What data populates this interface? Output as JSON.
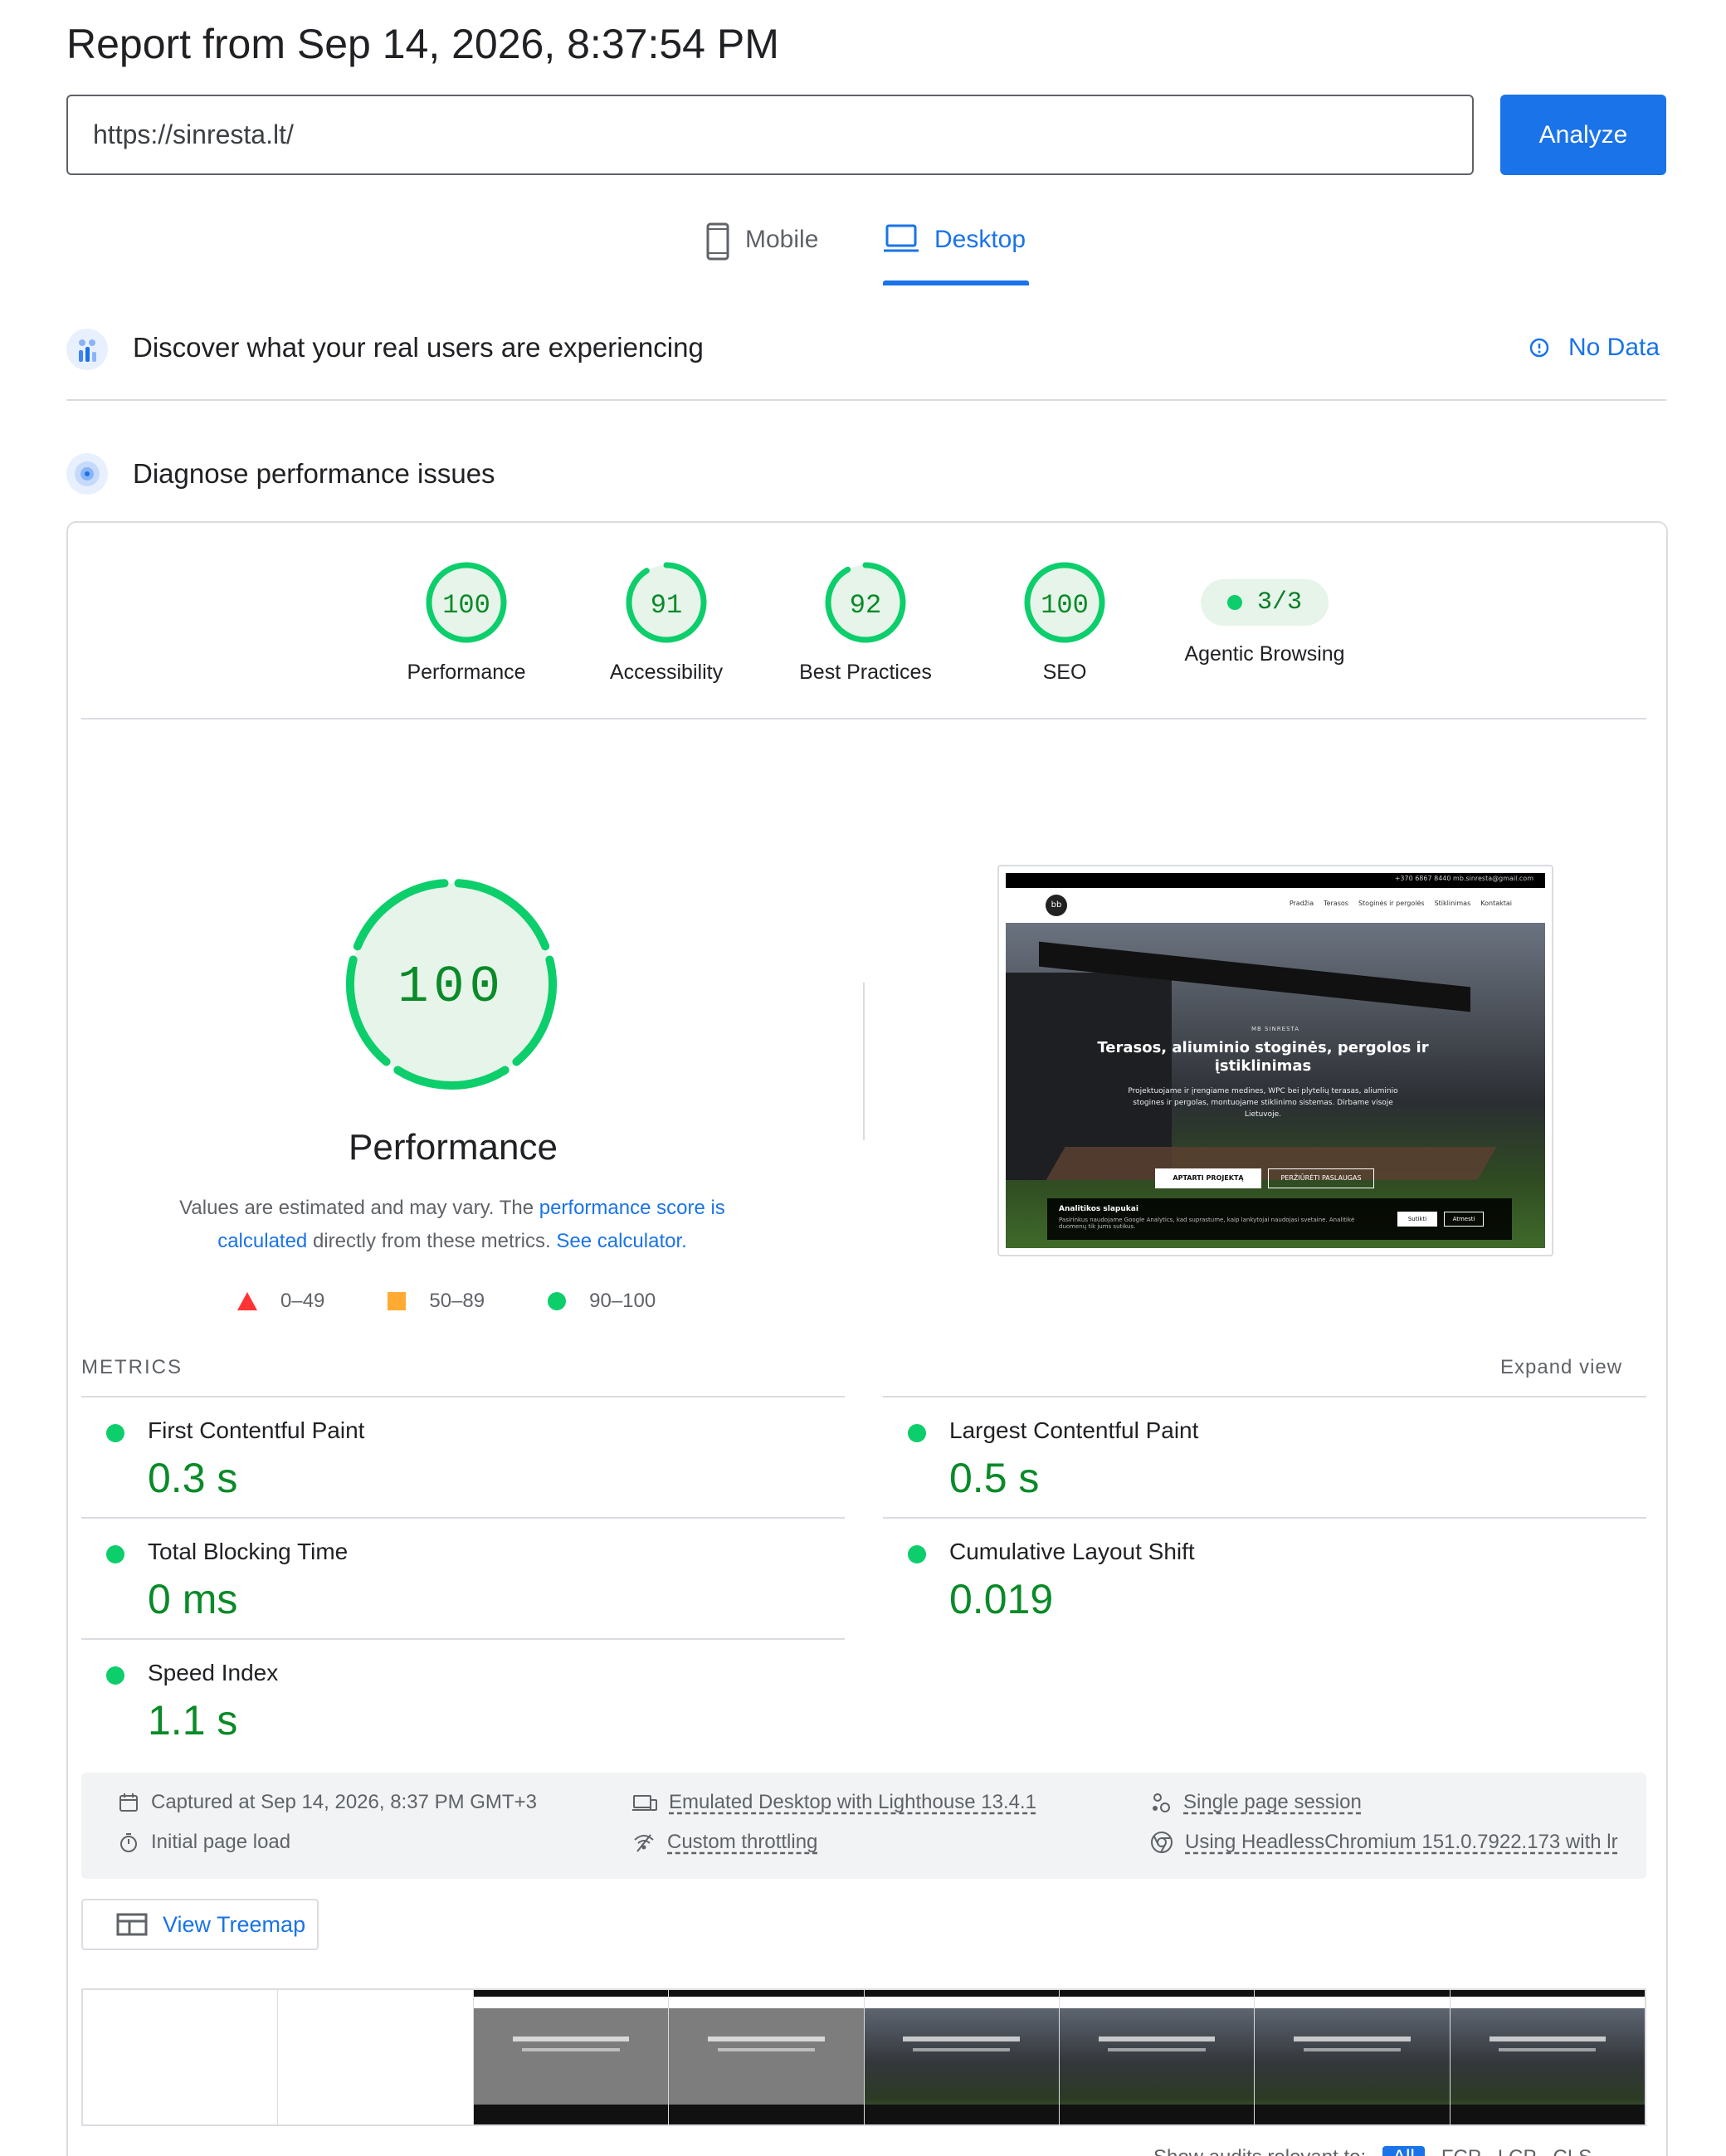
{
  "header": {
    "report_title": "Report from Sep 14, 2026, 8:37:54 PM",
    "url_value": "https://sinresta.lt/",
    "analyze_label": "Analyze"
  },
  "tabs": {
    "mobile_label": "Mobile",
    "desktop_label": "Desktop",
    "selected": "Desktop"
  },
  "crux": {
    "title": "Discover what your real users are experiencing",
    "status": "No Data"
  },
  "diagnose": {
    "title": "Diagnose performance issues"
  },
  "scores": [
    {
      "label": "Performance",
      "score": "100",
      "fraction": 1.0
    },
    {
      "label": "Accessibility",
      "score": "91",
      "fraction": 0.91
    },
    {
      "label": "Best Practices",
      "score": "92",
      "fraction": 0.92
    },
    {
      "label": "SEO",
      "score": "100",
      "fraction": 1.0
    }
  ],
  "agentic": {
    "label": "Agentic Browsing",
    "value": "3/3"
  },
  "performance_detail": {
    "score": "100",
    "label": "Performance",
    "desc_prefix": "Values are estimated and may vary. The ",
    "desc_link1": "performance score is calculated",
    "desc_middle": " directly from these metrics. ",
    "desc_link2": "See calculator."
  },
  "legend": {
    "fail": "0–49",
    "average": "50–89",
    "pass": "90–100"
  },
  "screenshot": {
    "topbar_text": "+370 6867 8440   mb.sinresta@gmail.com",
    "logo": "bb",
    "menu": [
      "Pradžia",
      "Terasos",
      "Stoginės ir pergolės",
      "Stiklinimas",
      "Kontaktai"
    ],
    "subtitle": "MB SINRESTA",
    "heading": "Terasos, aliuminio stoginės, pergolos ir įstiklinimas",
    "paragraph": "Projektuojame ir įrengiame medines, WPC bei plytelių terasas, aliuminio stogines ir pergolas, montuojame stiklinimo sistemas. Dirbame visoje Lietuvoje.",
    "button1": "APTARTI PROJEKTĄ",
    "button2": "PERŽIŪRĖTI PASLAUGAS",
    "cookie_title": "Analitikos slapukai",
    "cookie_text": "Pasirinkus naudojame Google Analytics, kad suprastume, kaip lankytojai naudojasi svetaine. Analitikė duomenų tik jums sutikus.",
    "cookie_accept": "Sutikti",
    "cookie_decline": "Atmesti"
  },
  "metrics": {
    "header": "METRICS",
    "expand": "Expand view",
    "items": [
      {
        "name": "First Contentful Paint",
        "value": "0.3 s"
      },
      {
        "name": "Largest Contentful Paint",
        "value": "0.5 s"
      },
      {
        "name": "Total Blocking Time",
        "value": "0 ms"
      },
      {
        "name": "Cumulative Layout Shift",
        "value": "0.019"
      },
      {
        "name": "Speed Index",
        "value": "1.1 s"
      }
    ]
  },
  "runtime": {
    "captured": "Captured at Sep 14, 2026, 8:37 PM GMT+3",
    "initial_load": "Initial page load",
    "emulated": "Emulated Desktop with Lighthouse 13.4.1",
    "throttling": "Custom throttling",
    "session": "Single page session",
    "browser": "Using HeadlessChromium 151.0.7922.173 with lr"
  },
  "treemap": {
    "label": "View Treemap"
  },
  "filter": {
    "prefix": "Show audits relevant to:",
    "options": [
      "All",
      "FCP",
      "LCP",
      "CLS"
    ]
  },
  "colors": {
    "pass": "#0cce6b",
    "pass_text": "#0a8a28",
    "accent": "#1a73e8",
    "average": "#ffaa33",
    "fail": "#ff3333"
  }
}
